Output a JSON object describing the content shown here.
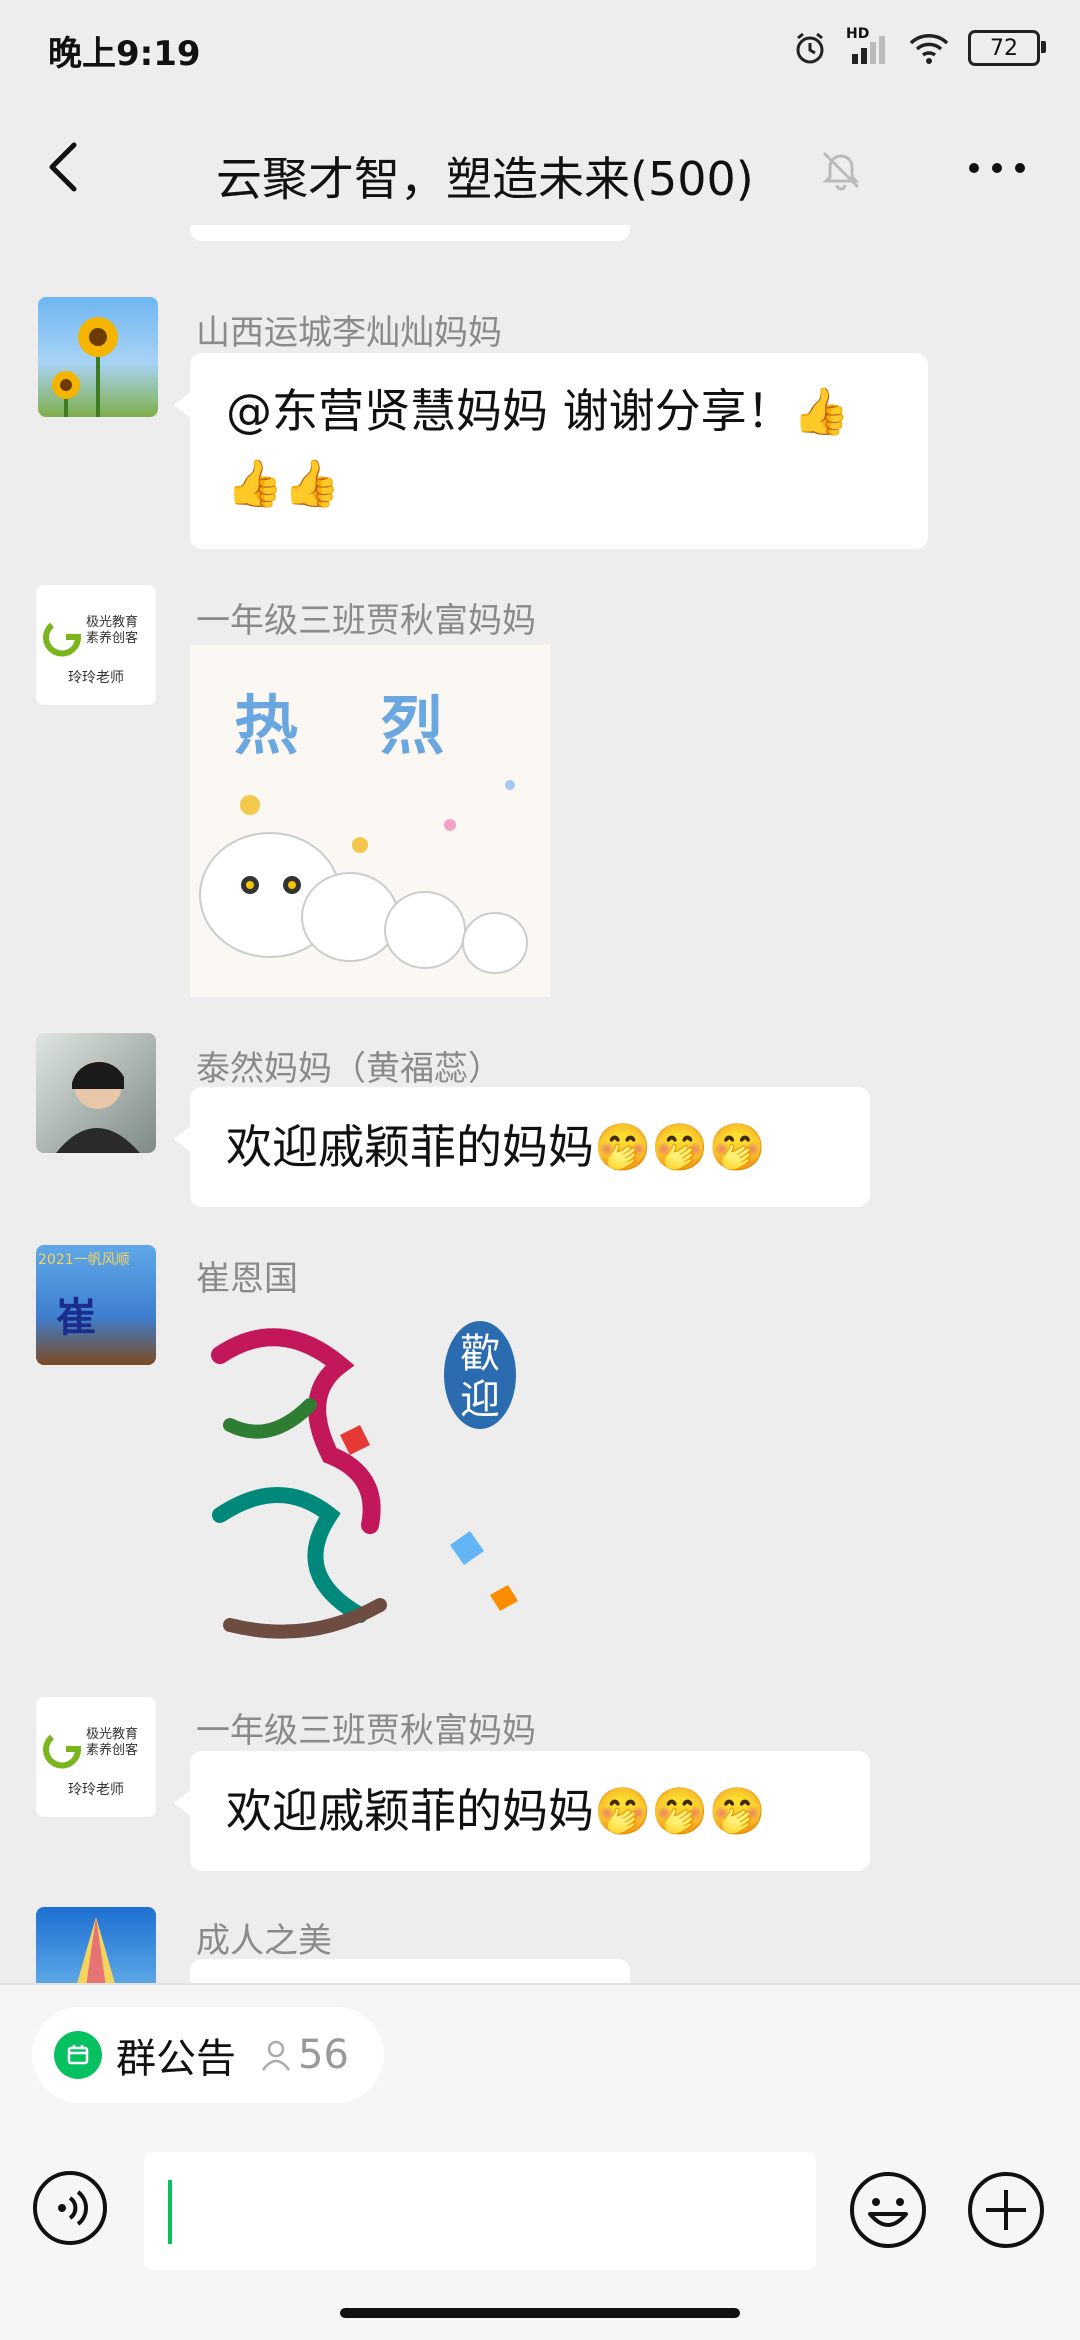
{
  "status": {
    "time": "晚上9:19",
    "battery": "72",
    "network_label": "HD"
  },
  "header": {
    "title": "云聚才智，塑造未来(500)",
    "back_icon": "chevron-left-icon",
    "mute_icon": "bell-off-icon",
    "more_icon": "more-dots-icon"
  },
  "messages": [
    {
      "sender": "山西运城李灿灿妈妈",
      "text_line1": "@东营贤慧妈妈  谢谢分享！👍",
      "text_line2": "👍👍"
    },
    {
      "sender": "一年级三班贾秋富妈妈",
      "sticker_text": "热 烈",
      "avatar_brand": "极光教育 素养创客",
      "avatar_caption": "玲玲老师"
    },
    {
      "sender": "泰然妈妈（黄福蕊）",
      "text": "欢迎戚颖菲的妈妈🤭🤭🤭"
    },
    {
      "sender": "崔恩国",
      "sticker_text": "歡迎",
      "avatar_text": "2021一帆风顺",
      "avatar_char": "崔"
    },
    {
      "sender": "一年级三班贾秋富妈妈",
      "text": "欢迎戚颖菲的妈妈🤭🤭🤭",
      "avatar_brand": "极光教育 素养创客",
      "avatar_caption": "玲玲老师"
    },
    {
      "sender": "成人之美"
    }
  ],
  "bottom": {
    "notice_label": "群公告",
    "member_count": "56",
    "voice_icon": "voice-icon",
    "emoji_icon": "smile-icon",
    "plus_icon": "plus-circle-icon"
  },
  "colors": {
    "accent": "#07c160",
    "background": "#ededed",
    "bubble": "#ffffff"
  }
}
